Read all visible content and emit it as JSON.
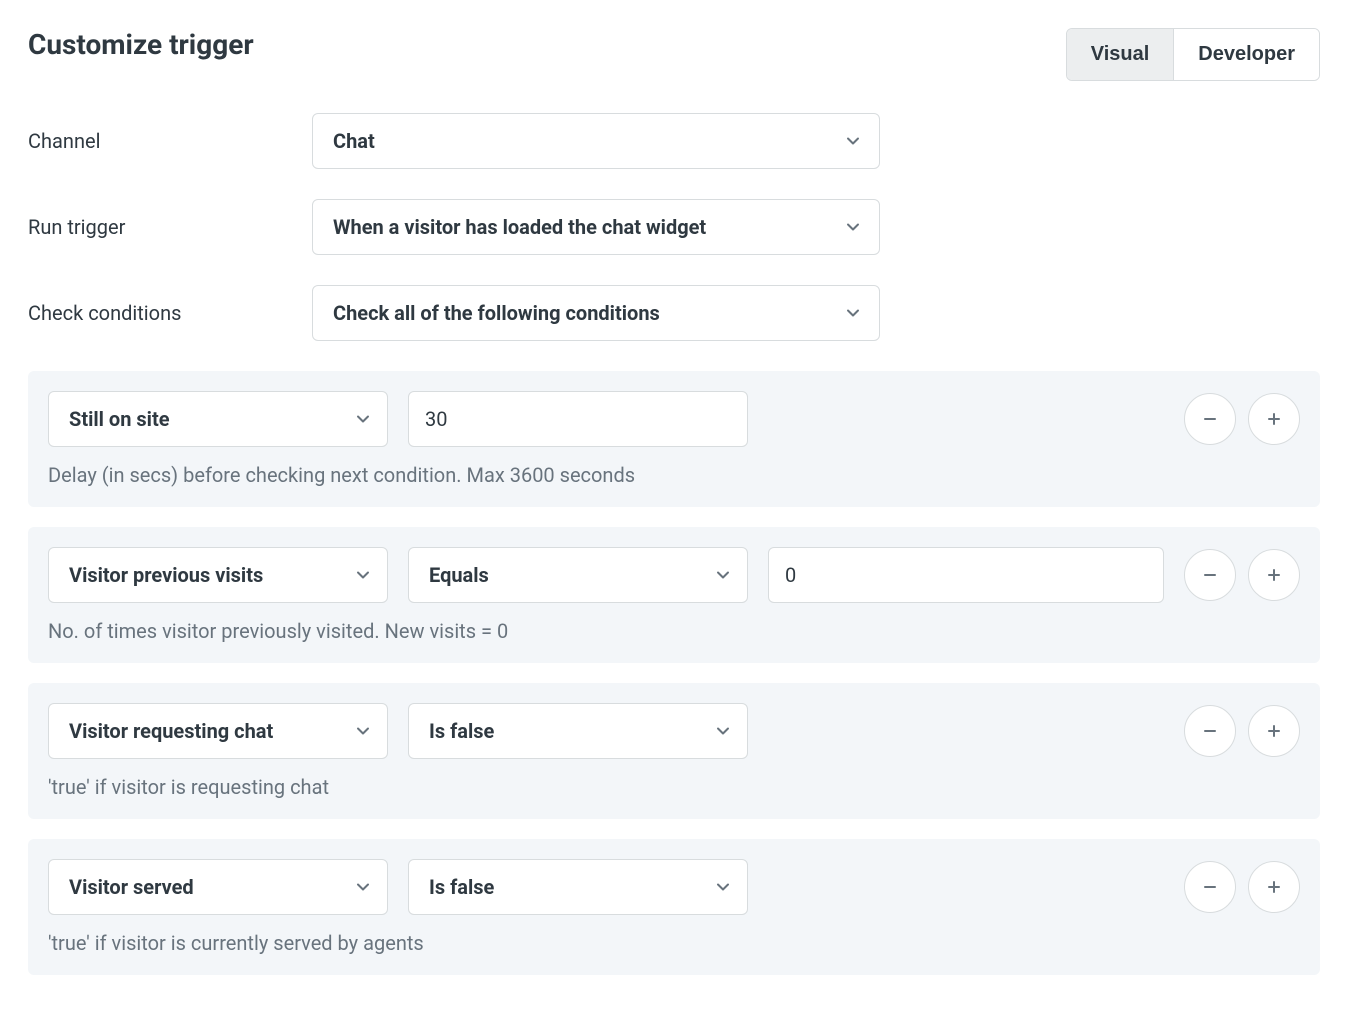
{
  "header": {
    "title": "Customize trigger",
    "tabs": {
      "visual": "Visual",
      "developer": "Developer"
    }
  },
  "form": {
    "channel_label": "Channel",
    "channel_value": "Chat",
    "run_label": "Run trigger",
    "run_value": "When a visitor has loaded the chat widget",
    "check_label": "Check conditions",
    "check_value": "Check all of the following conditions"
  },
  "conditions": [
    {
      "field": "Still on site",
      "value": "30",
      "hint": "Delay (in secs) before checking next condition. Max 3600 seconds"
    },
    {
      "field": "Visitor previous visits",
      "operator": "Equals",
      "value": "0",
      "hint": "No. of times visitor previously visited. New visits = 0"
    },
    {
      "field": "Visitor requesting chat",
      "operator": "Is false",
      "hint": "'true' if visitor is requesting chat"
    },
    {
      "field": "Visitor served",
      "operator": "Is false",
      "hint": "'true' if visitor is currently served by agents"
    }
  ]
}
